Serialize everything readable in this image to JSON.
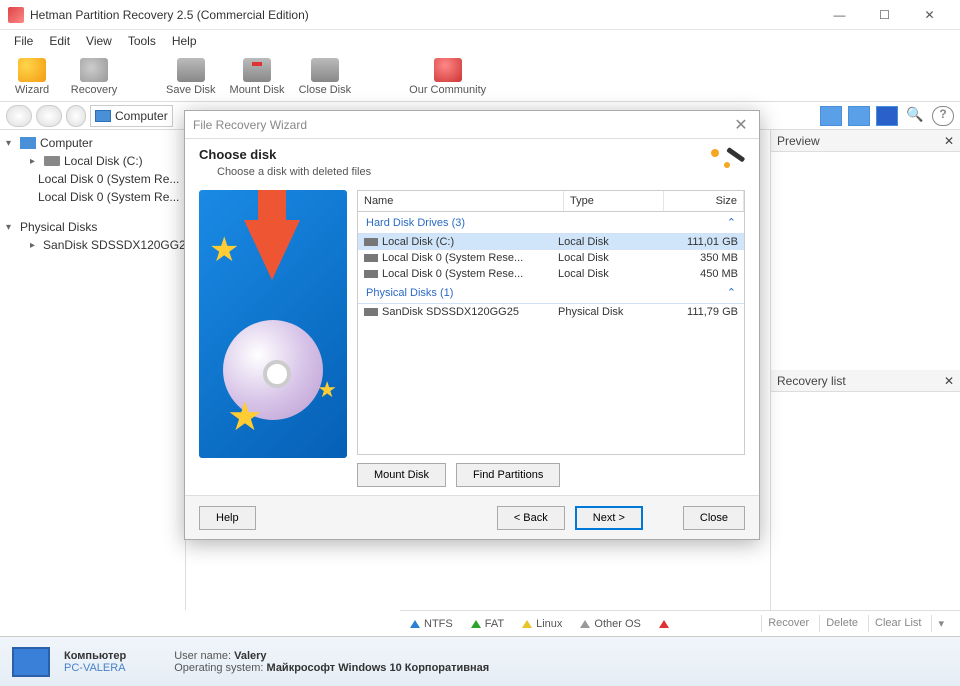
{
  "window_title": "Hetman Partition Recovery 2.5 (Commercial Edition)",
  "menu": {
    "file": "File",
    "edit": "Edit",
    "view": "View",
    "tools": "Tools",
    "help": "Help"
  },
  "toolbar": {
    "wizard": "Wizard",
    "recovery": "Recovery",
    "save_disk": "Save Disk",
    "mount_disk": "Mount Disk",
    "close_disk": "Close Disk",
    "community": "Our Community"
  },
  "address": {
    "label": "Computer"
  },
  "tree": {
    "computer": "Computer",
    "local_c": "Local Disk (C:)",
    "local_0a": "Local Disk 0 (System Re...",
    "local_0b": "Local Disk 0 (System Re...",
    "physical": "Physical Disks",
    "sandisk": "SanDisk SDSSDX120GG2..."
  },
  "right_panels": {
    "preview": "Preview",
    "recovery_list": "Recovery list"
  },
  "legend": {
    "ntfs": "NTFS",
    "fat": "FAT",
    "linux": "Linux",
    "other": "Other OS",
    "recover": "Recover",
    "delete": "Delete",
    "clear": "Clear List"
  },
  "status": {
    "computer_label": "Компьютер",
    "pc_name": "PC-VALERA",
    "user_name_label": "User name:",
    "user_name": "Valery",
    "os_label": "Operating system:",
    "os": "Майкрософт Windows 10 Корпоративная"
  },
  "dialog": {
    "title": "File Recovery Wizard",
    "heading": "Choose disk",
    "subheading": "Choose a disk with deleted files",
    "columns": {
      "name": "Name",
      "type": "Type",
      "size": "Size"
    },
    "group_hdd": "Hard Disk Drives (3)",
    "group_phys": "Physical Disks (1)",
    "rows": {
      "r1_name": "Local Disk (C:)",
      "r1_type": "Local Disk",
      "r1_size": "111,01 GB",
      "r2_name": "Local Disk 0 (System Rese...",
      "r2_type": "Local Disk",
      "r2_size": "350 MB",
      "r3_name": "Local Disk 0 (System Rese...",
      "r3_type": "Local Disk",
      "r3_size": "450 MB",
      "r4_name": "SanDisk SDSSDX120GG25",
      "r4_type": "Physical Disk",
      "r4_size": "111,79 GB"
    },
    "buttons": {
      "mount_disk": "Mount Disk",
      "find_partitions": "Find Partitions",
      "help": "Help",
      "back": "< Back",
      "next": "Next >",
      "close": "Close"
    }
  }
}
